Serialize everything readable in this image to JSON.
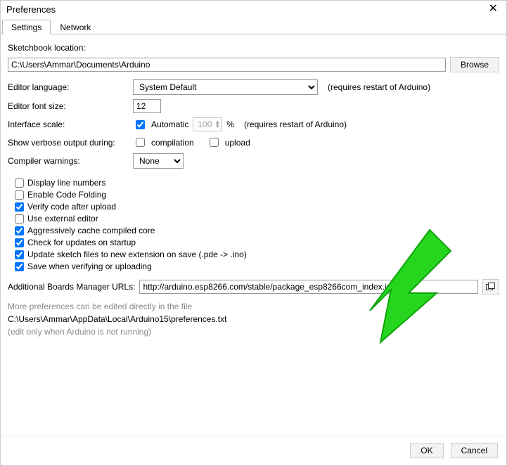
{
  "window": {
    "title": "Preferences"
  },
  "tabs": {
    "settings": "Settings",
    "network": "Network"
  },
  "form": {
    "sketchbookLabel": "Sketchbook location:",
    "sketchbookPath": "C:\\Users\\Ammar\\Documents\\Arduino",
    "browse": "Browse",
    "languageLabel": "Editor language:",
    "languageValue": "System Default",
    "languageHint": "(requires restart of Arduino)",
    "fontSizeLabel": "Editor font size:",
    "fontSizeValue": "12",
    "scaleLabel": "Interface scale:",
    "scaleAuto": "Automatic",
    "scaleValue": "100",
    "scalePct": "%",
    "scaleHint": "(requires restart of Arduino)",
    "verboseLabel": "Show verbose output during:",
    "verboseCompile": "compilation",
    "verboseUpload": "upload",
    "warningsLabel": "Compiler warnings:",
    "warningsValue": "None",
    "cbDisplayLines": "Display line numbers",
    "cbCodeFolding": "Enable Code Folding",
    "cbVerify": "Verify code after upload",
    "cbExternal": "Use external editor",
    "cbCache": "Aggressively cache compiled core",
    "cbUpdates": "Check for updates on startup",
    "cbExtension": "Update sketch files to new extension on save (.pde -> .ino)",
    "cbSave": "Save when verifying or uploading",
    "boardsLabel": "Additional Boards Manager URLs:",
    "boardsUrl": "http://arduino.esp8266.com/stable/package_esp8266com_index.json",
    "prefsNote": "More preferences can be edited directly in the file",
    "prefsPath": "C:\\Users\\Ammar\\AppData\\Local\\Arduino15\\preferences.txt",
    "prefsHint": "(edit only when Arduino is not running)"
  },
  "buttons": {
    "ok": "OK",
    "cancel": "Cancel"
  }
}
